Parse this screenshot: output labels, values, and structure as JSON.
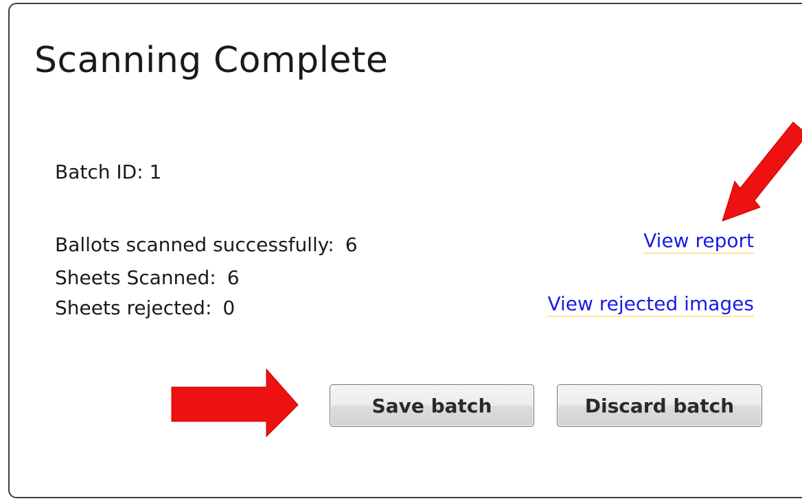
{
  "dialog": {
    "title": "Scanning Complete",
    "batch_id_label": "Batch ID:",
    "batch_id_value": "1",
    "stats": {
      "ballots_label": "Ballots scanned successfully:",
      "ballots_value": "6",
      "sheets_label": "Sheets Scanned:",
      "sheets_value": "6",
      "rejected_label": "Sheets rejected:",
      "rejected_value": "0"
    },
    "links": {
      "view_report": "View report",
      "view_rejected": "View rejected images"
    },
    "buttons": {
      "save": "Save batch",
      "discard": "Discard batch"
    }
  },
  "colors": {
    "link": "#1a1ae6",
    "annotation_arrow": "#ee1111"
  },
  "icons": [
    "annotation-arrow-icon"
  ]
}
